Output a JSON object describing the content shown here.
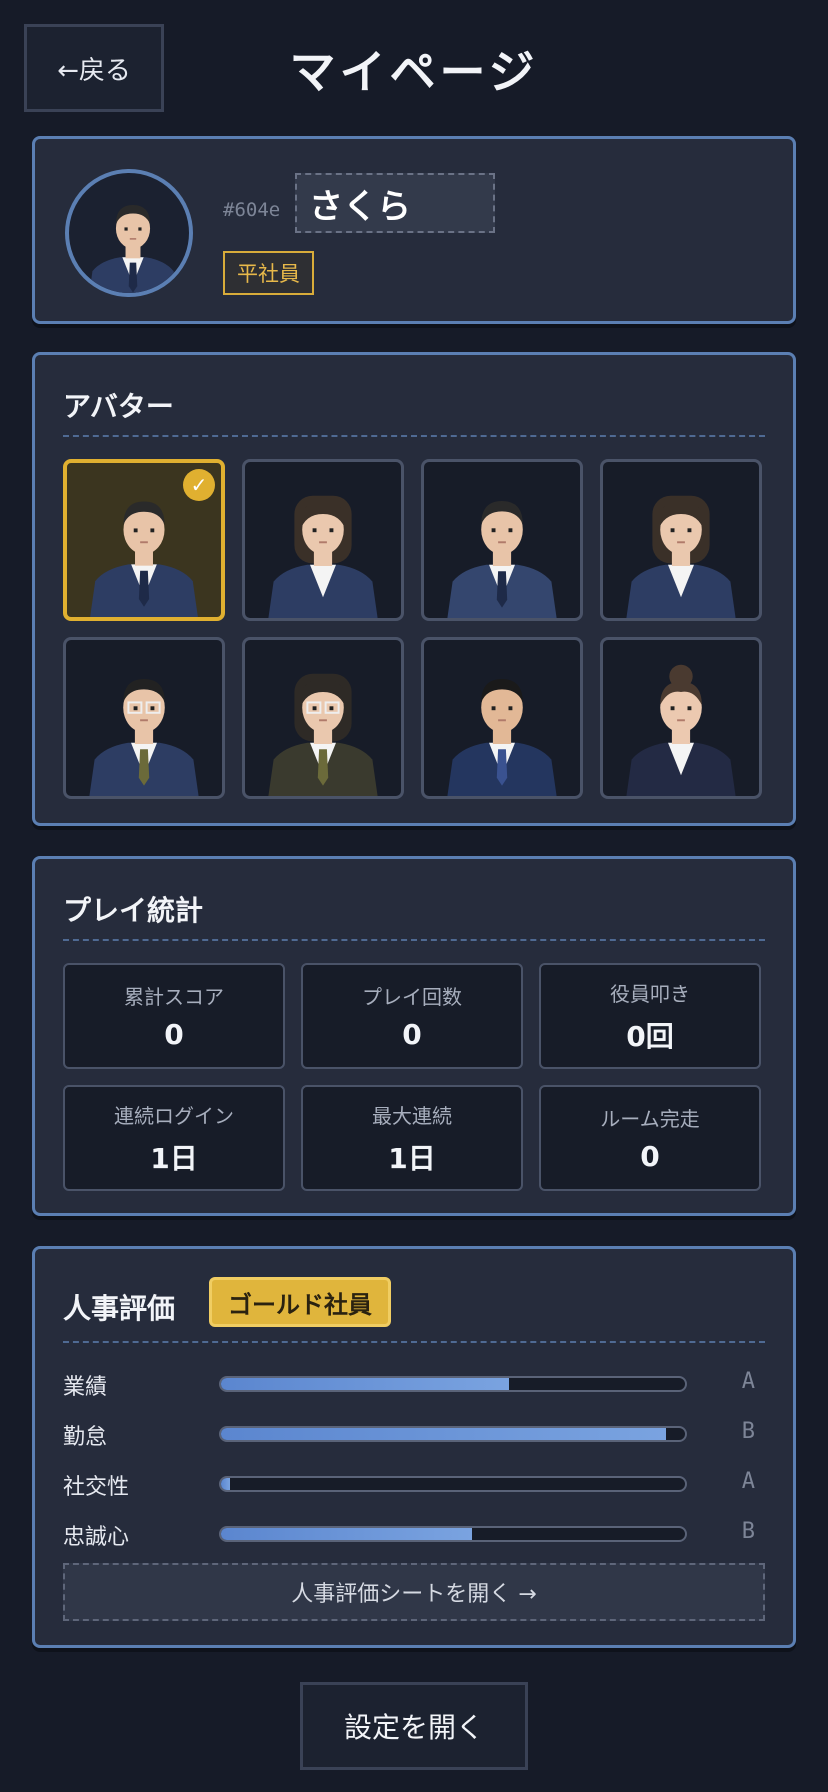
{
  "header": {
    "back_label": "←戻る",
    "title": "マイページ"
  },
  "profile": {
    "user_id": "#604e",
    "name": "さくら",
    "rank": "平社員"
  },
  "avatars": {
    "title": "アバター",
    "selected_index": 0,
    "items": [
      {
        "type": "man-suit",
        "skin": "#e8c4a8",
        "hair": "#2a2a2a",
        "suit": "#2d3d63",
        "tie": "#1e2a48",
        "bg": "#3b351f"
      },
      {
        "type": "woman-long-hair",
        "skin": "#eac8ae",
        "hair": "#3a3028",
        "suit": "#2d3d63",
        "tie": "#ffffff",
        "bg": "#171c28"
      },
      {
        "type": "man-suit",
        "skin": "#e8c4a8",
        "hair": "#2a2a2a",
        "suit": "#34466e",
        "tie": "#1e2a48",
        "bg": "#171c28"
      },
      {
        "type": "woman-long-hair",
        "skin": "#eac8ae",
        "hair": "#3a3028",
        "suit": "#2d3d63",
        "tie": "#ffffff",
        "bg": "#171c28"
      },
      {
        "type": "man-glasses",
        "skin": "#e8c4a8",
        "hair": "#222222",
        "suit": "#2d3d63",
        "tie": "#6b6a3a",
        "bg": "#171c28"
      },
      {
        "type": "woman-glasses",
        "skin": "#eac8ae",
        "hair": "#2e2a26",
        "suit": "#3a3a2e",
        "tie": "#6b6a3a",
        "bg": "#171c28"
      },
      {
        "type": "man-slick",
        "skin": "#e2b896",
        "hair": "#1a1a1a",
        "suit": "#24365f",
        "tie": "#3a5290",
        "bg": "#171c28"
      },
      {
        "type": "woman-bun",
        "skin": "#ecc9b0",
        "hair": "#4a3a30",
        "suit": "#232a44",
        "tie": "#ffffff",
        "bg": "#171c28"
      }
    ]
  },
  "stats": {
    "title": "プレイ統計",
    "items": [
      {
        "label": "累計スコア",
        "value": "0"
      },
      {
        "label": "プレイ回数",
        "value": "0"
      },
      {
        "label": "役員叩き",
        "value": "0回"
      },
      {
        "label": "連続ログイン",
        "value": "1日"
      },
      {
        "label": "最大連続",
        "value": "1日"
      },
      {
        "label": "ルーム完走",
        "value": "0"
      }
    ]
  },
  "evaluation": {
    "title": "人事評価",
    "badge": "ゴールド社員",
    "rows": [
      {
        "label": "業績",
        "value": 0.62,
        "grade": "A"
      },
      {
        "label": "勤怠",
        "value": 0.96,
        "grade": "B"
      },
      {
        "label": "社交性",
        "value": 0.02,
        "grade": "A"
      },
      {
        "label": "忠誠心",
        "value": 0.54,
        "grade": "B"
      }
    ],
    "sheet_button": "人事評価シートを開く →"
  },
  "footer": {
    "settings_label": "設定を開く"
  },
  "colors": {
    "accent": "#5b7fb3",
    "gold": "#e0b53c",
    "background": "#161b28",
    "panel": "#262c3c"
  }
}
